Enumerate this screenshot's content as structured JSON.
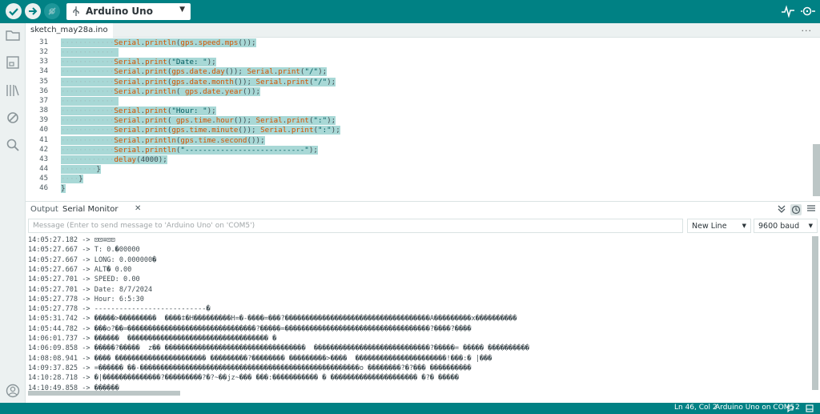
{
  "toolbar": {
    "board": "Arduino Uno",
    "verify_icon": "check-icon",
    "upload_icon": "arrow-right-icon",
    "debug_icon": "debug-icon",
    "plotter_icon": "serial-plotter-icon",
    "monitor_icon": "serial-monitor-icon"
  },
  "sidebar": {
    "items": [
      "folder-icon",
      "boards-manager-icon",
      "library-icon",
      "debug-icon",
      "search-icon",
      "account-icon"
    ]
  },
  "editor": {
    "tab": "sketch_may28a.ino",
    "more": "...",
    "lines": [
      {
        "n": "31",
        "segs": [
          [
            "kw",
            "Serial"
          ],
          [
            "",
            "."
          ],
          [
            "kw",
            "println"
          ],
          [
            "",
            "("
          ],
          [
            "kw",
            "gps"
          ],
          [
            "",
            "."
          ],
          [
            "kw",
            "speed"
          ],
          [
            "",
            "."
          ],
          [
            "kw",
            "mps"
          ],
          [
            "",
            "());"
          ]
        ]
      },
      {
        "n": "32",
        "segs": []
      },
      {
        "n": "33",
        "segs": [
          [
            "kw",
            "Serial"
          ],
          [
            "",
            "."
          ],
          [
            "kw",
            "print"
          ],
          [
            "",
            "("
          ],
          [
            "str",
            "\"Date: \""
          ],
          [
            "",
            ");"
          ]
        ]
      },
      {
        "n": "34",
        "segs": [
          [
            "kw",
            "Serial"
          ],
          [
            "",
            "."
          ],
          [
            "kw",
            "print"
          ],
          [
            "",
            "("
          ],
          [
            "kw",
            "gps"
          ],
          [
            "",
            "."
          ],
          [
            "kw",
            "date"
          ],
          [
            "",
            "."
          ],
          [
            "kw",
            "day"
          ],
          [
            "",
            "()); "
          ],
          [
            "kw",
            "Serial"
          ],
          [
            "",
            "."
          ],
          [
            "kw",
            "print"
          ],
          [
            "",
            "("
          ],
          [
            "str",
            "\"/\""
          ],
          [
            "",
            ");"
          ]
        ]
      },
      {
        "n": "35",
        "segs": [
          [
            "kw",
            "Serial"
          ],
          [
            "",
            "."
          ],
          [
            "kw",
            "print"
          ],
          [
            "",
            "("
          ],
          [
            "kw",
            "gps"
          ],
          [
            "",
            "."
          ],
          [
            "kw",
            "date"
          ],
          [
            "",
            "."
          ],
          [
            "kw",
            "month"
          ],
          [
            "",
            "()); "
          ],
          [
            "kw",
            "Serial"
          ],
          [
            "",
            "."
          ],
          [
            "kw",
            "print"
          ],
          [
            "",
            "("
          ],
          [
            "str",
            "\"/\""
          ],
          [
            "",
            ");"
          ]
        ]
      },
      {
        "n": "36",
        "segs": [
          [
            "kw",
            "Serial"
          ],
          [
            "",
            "."
          ],
          [
            "kw",
            "println"
          ],
          [
            "",
            "( "
          ],
          [
            "kw",
            "gps"
          ],
          [
            "",
            "."
          ],
          [
            "kw",
            "date"
          ],
          [
            "",
            "."
          ],
          [
            "kw",
            "year"
          ],
          [
            "",
            "());"
          ]
        ]
      },
      {
        "n": "37",
        "segs": []
      },
      {
        "n": "38",
        "segs": [
          [
            "kw",
            "Serial"
          ],
          [
            "",
            "."
          ],
          [
            "kw",
            "print"
          ],
          [
            "",
            "("
          ],
          [
            "str",
            "\"Hour: \""
          ],
          [
            "",
            ");"
          ]
        ]
      },
      {
        "n": "39",
        "segs": [
          [
            "kw",
            "Serial"
          ],
          [
            "",
            "."
          ],
          [
            "kw",
            "print"
          ],
          [
            "",
            "( "
          ],
          [
            "kw",
            "gps"
          ],
          [
            "",
            "."
          ],
          [
            "kw",
            "time"
          ],
          [
            "",
            "."
          ],
          [
            "kw",
            "hour"
          ],
          [
            "",
            "()); "
          ],
          [
            "kw",
            "Serial"
          ],
          [
            "",
            "."
          ],
          [
            "kw",
            "print"
          ],
          [
            "",
            "("
          ],
          [
            "str",
            "\":\""
          ],
          [
            "",
            ");"
          ]
        ]
      },
      {
        "n": "40",
        "segs": [
          [
            "kw",
            "Serial"
          ],
          [
            "",
            "."
          ],
          [
            "kw",
            "print"
          ],
          [
            "",
            "("
          ],
          [
            "kw",
            "gps"
          ],
          [
            "",
            "."
          ],
          [
            "kw",
            "time"
          ],
          [
            "",
            "."
          ],
          [
            "kw",
            "minute"
          ],
          [
            "",
            "()); "
          ],
          [
            "kw",
            "Serial"
          ],
          [
            "",
            "."
          ],
          [
            "kw",
            "print"
          ],
          [
            "",
            "("
          ],
          [
            "str",
            "\":\""
          ],
          [
            "",
            ");"
          ]
        ]
      },
      {
        "n": "41",
        "segs": [
          [
            "kw",
            "Serial"
          ],
          [
            "",
            "."
          ],
          [
            "kw",
            "println"
          ],
          [
            "",
            "("
          ],
          [
            "kw",
            "gps"
          ],
          [
            "",
            "."
          ],
          [
            "kw",
            "time"
          ],
          [
            "",
            "."
          ],
          [
            "kw",
            "second"
          ],
          [
            "",
            "());"
          ]
        ]
      },
      {
        "n": "42",
        "segs": [
          [
            "kw",
            "Serial"
          ],
          [
            "",
            "."
          ],
          [
            "kw",
            "println"
          ],
          [
            "",
            "("
          ],
          [
            "str",
            "\"---------------------------\""
          ],
          [
            "",
            ");"
          ]
        ]
      },
      {
        "n": "43",
        "segs": [
          [
            "kw",
            "delay"
          ],
          [
            "",
            "(4000);"
          ]
        ]
      },
      {
        "n": "44",
        "segs": [
          [
            "",
            "}"
          ]
        ]
      },
      {
        "n": "45",
        "segs": [
          [
            "",
            "}"
          ]
        ]
      },
      {
        "n": "46",
        "segs": [
          [
            "",
            "}"
          ]
        ]
      }
    ]
  },
  "panel": {
    "tab_output": "Output",
    "tab_serial": "Serial Monitor",
    "close": "✕",
    "message_placeholder": "Message (Enter to send message to 'Arduino Uno' on 'COM5')",
    "line_ending": "New Line",
    "baud": "9600 baud",
    "lines": [
      "14:05:27.182 -> ⊡⊡≡⊡⊡",
      "14:05:27.667 -> T: 0.�00000",
      "14:05:27.667 -> LONG: 0.000000�",
      "14:05:27.667 -> ALT� 0.00",
      "14:05:27.701 -> SPEED: 0.00",
      "14:05:27.701 -> Date: 8/7/2024",
      "14:05:27.778 -> Hour: 6:5:30",
      "14:05:27.778 -> ---------------------------�",
      "14:05:31.742 -> �����>���������  ����‡�H���������H=�-����=���?�����������������������������������A���������x����������",
      "14:05:44.782 -> ���o?��=�������������������������������?�����=�����������������������������������?����?����",
      "14:06:01.737 -> ������  ���������������������������������� �",
      "14:06:09.858 -> �����?�����  z�� ����������������������������������  ����������������������������?�����= ����� ����������",
      "14:08:08.941 -> ���� ���������������������� ���������?�������� ���������>����  ����������������������!���:� |���",
      "14:09:37.825 -> =������ ��-�����������������������������������������������������o ��������?�?��� ����������",
      "14:10:28.718 -> �|��������������?���������?�?~��jz~��� ���:����������� � ��������������������� �?� �����",
      "14:10:49.858 -> ������"
    ]
  },
  "status": {
    "position": "Ln 46, Col 2",
    "board_port": "Arduino Uno on COM5",
    "notifications": "2"
  }
}
